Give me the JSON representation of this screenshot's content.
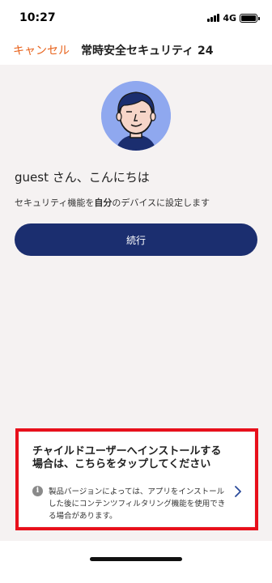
{
  "status_bar": {
    "time": "10:27",
    "network": "4G",
    "icons": [
      "signal-icon",
      "battery-icon"
    ]
  },
  "nav": {
    "cancel_label": "キャンセル",
    "title": "常時安全セキュリティ 24"
  },
  "main": {
    "greeting": "guest さん、こんにちは",
    "subtitle_prefix": "セキュリティ機能を",
    "subtitle_bold": "自分",
    "subtitle_suffix": "のデバイスに設定します",
    "continue_label": "続行"
  },
  "child_card": {
    "title": "チャイルドユーザーへインストールする場合は、こちらをタップしてください",
    "description": "製品バージョンによっては、アプリをインストールした後にコンテンツフィルタリング機能を使用できる場合があります。",
    "icons": [
      "info-icon",
      "chevron-right-icon"
    ]
  },
  "colors": {
    "accent": "#e8641e",
    "primary_button": "#1b2e6f",
    "avatar_bg": "#8fa8ef",
    "highlight": "#e8101b",
    "background": "#f5f2f2"
  }
}
